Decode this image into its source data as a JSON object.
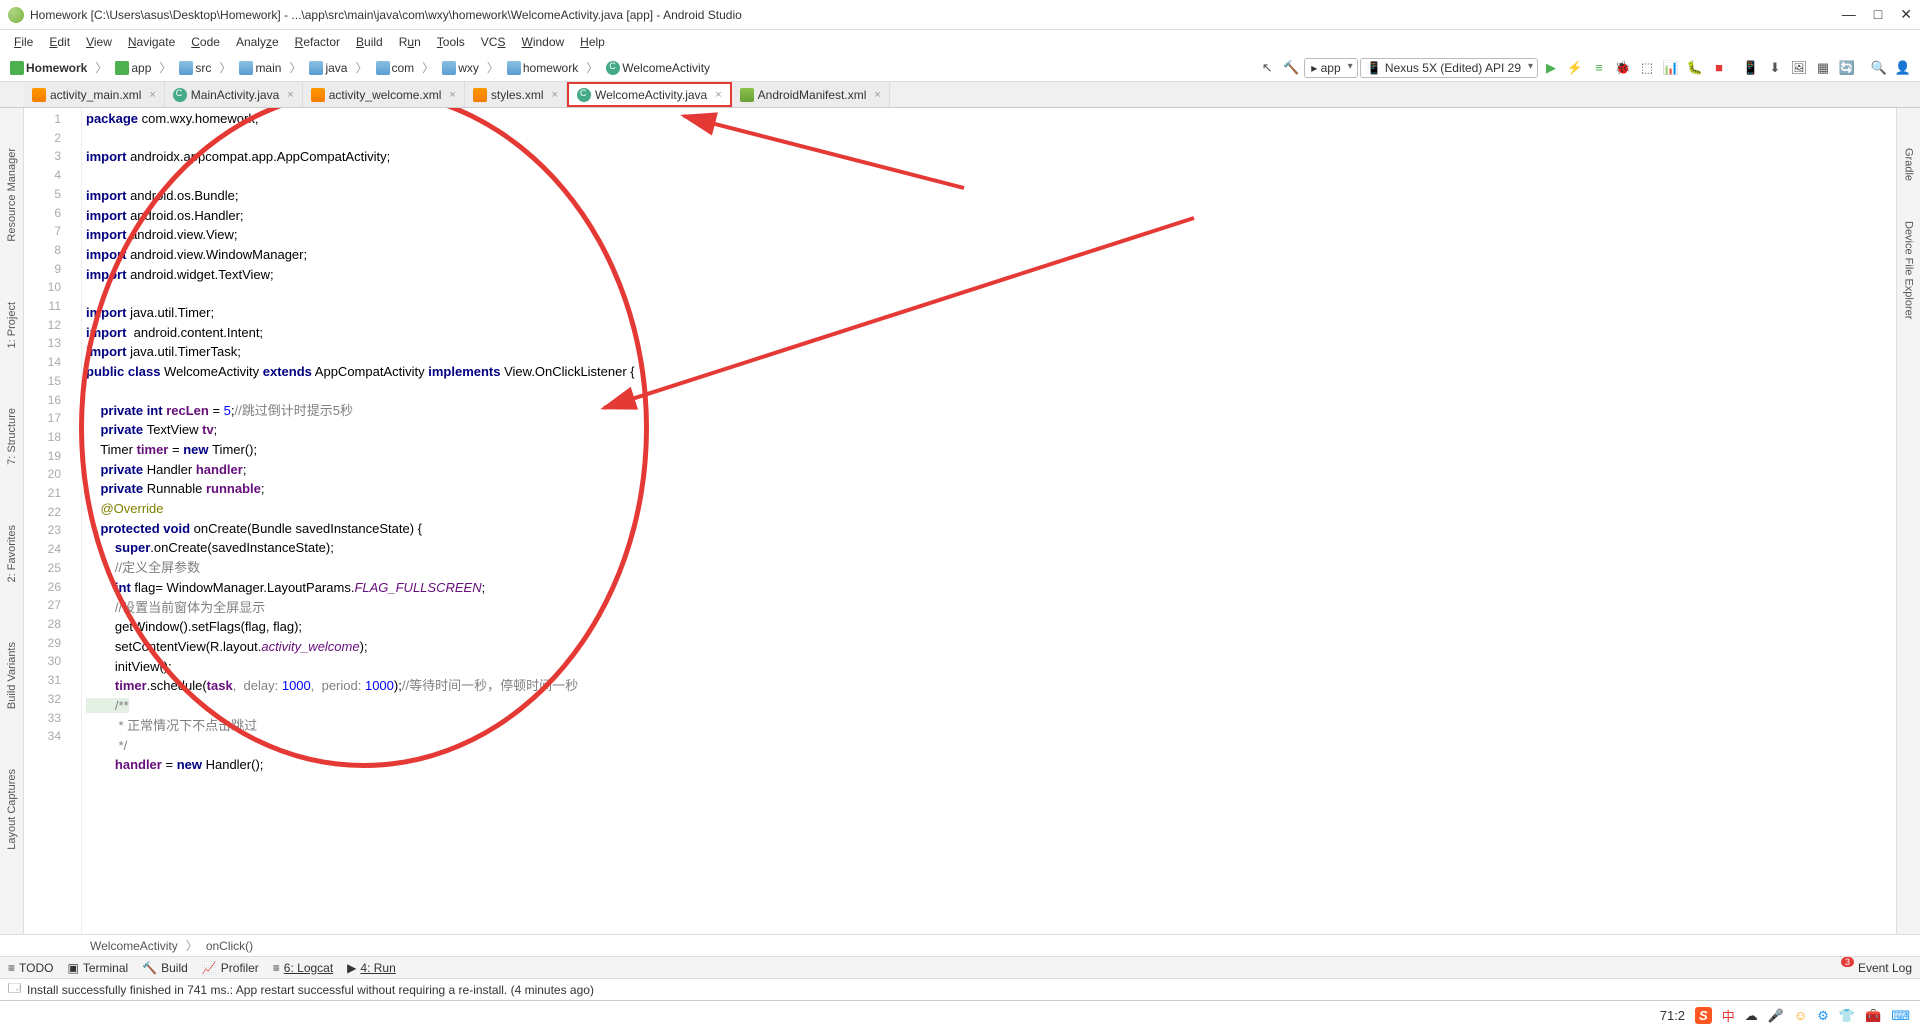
{
  "window": {
    "title": "Homework [C:\\Users\\asus\\Desktop\\Homework] - ...\\app\\src\\main\\java\\com\\wxy\\homework\\WelcomeActivity.java [app] - Android Studio",
    "minimize": "—",
    "maximize": "□",
    "close": "✕"
  },
  "menu": {
    "items": [
      "File",
      "Edit",
      "View",
      "Navigate",
      "Code",
      "Analyze",
      "Refactor",
      "Build",
      "Run",
      "Tools",
      "VCS",
      "Window",
      "Help"
    ]
  },
  "breadcrumb": {
    "items": [
      "Homework",
      "app",
      "src",
      "main",
      "java",
      "com",
      "wxy",
      "homework",
      "WelcomeActivity"
    ]
  },
  "run": {
    "config": "app",
    "device": "Nexus 5X (Edited) API 29"
  },
  "tabs": {
    "items": [
      {
        "label": "activity_main.xml",
        "type": "xml"
      },
      {
        "label": "MainActivity.java",
        "type": "java"
      },
      {
        "label": "activity_welcome.xml",
        "type": "xml"
      },
      {
        "label": "styles.xml",
        "type": "xml"
      },
      {
        "label": "WelcomeActivity.java",
        "type": "java",
        "active": true
      },
      {
        "label": "AndroidManifest.xml",
        "type": "mf"
      }
    ]
  },
  "left_tools": [
    "Resource Manager",
    "1: Project",
    "7: Structure",
    "2: Favorites",
    "Build Variants",
    "Layout Captures"
  ],
  "right_tools": [
    "Gradle",
    "Device File Explorer"
  ],
  "gutter_lines": [
    "1",
    "2",
    "3",
    "4",
    "5",
    "6",
    "7",
    "8",
    "9",
    "10",
    "11",
    "12",
    "13",
    "14",
    "15",
    "16",
    "17",
    "18",
    "19",
    "20",
    "21",
    "22",
    "23",
    "24",
    "25",
    "26",
    "27",
    "28",
    "29",
    "30",
    "31",
    "32",
    "33",
    "34"
  ],
  "code": {
    "l1a": "package",
    "l1b": " com.wxy.homework;",
    "l3a": "import",
    "l3b": " androidx.appcompat.app.AppCompatActivity;",
    "l5a": "import",
    "l5b": " android.os.Bundle;",
    "l6a": "import",
    "l6b": " android.os.Handler;",
    "l7a": "import",
    "l7b": " android.view.View;",
    "l8a": "import",
    "l8b": " android.view.WindowManager;",
    "l9a": "import",
    "l9b": " android.widget.TextView;",
    "l11a": "import",
    "l11b": " java.util.Timer;",
    "l12a": "import",
    "l12b": "  android.content.Intent;",
    "l13a": "import",
    "l13b": " java.util.TimerTask;",
    "l14a": "public class",
    "l14b": " WelcomeActivity ",
    "l14c": "extends",
    "l14d": " AppCompatActivity ",
    "l14e": "implements",
    "l14f": " View.OnClickListener {",
    "l16a": "    private int ",
    "l16b": "recLen",
    "l16c": " = ",
    "l16d": "5",
    "l16e": ";",
    "l16f": "//跳过倒计时提示5秒",
    "l17a": "    private ",
    "l17b": "TextView ",
    "l17c": "tv",
    "l17d": ";",
    "l18a": "    Timer ",
    "l18b": "timer",
    "l18c": " = ",
    "l18d": "new ",
    "l18e": "Timer();",
    "l19a": "    private ",
    "l19b": "Handler ",
    "l19c": "handler",
    "l19d": ";",
    "l20a": "    private ",
    "l20b": "Runnable ",
    "l20c": "runnable",
    "l20d": ";",
    "l21a": "    @Override",
    "l22a": "    protected void ",
    "l22b": "onCreate(Bundle savedInstanceState) {",
    "l23a": "        super",
    "l23b": ".onCreate(savedInstanceState);",
    "l24a": "        //定义全屏参数",
    "l25a": "        int ",
    "l25b": "flag= WindowManager.LayoutParams.",
    "l25c": "FLAG_FULLSCREEN",
    "l25d": ";",
    "l26a": "        //设置当前窗体为全屏显示",
    "l27a": "        getWindow().setFlags(flag, flag);",
    "l28a": "        setContentView(R.layout.",
    "l28b": "activity_welcome",
    "l28c": ");",
    "l29a": "        initView();",
    "l30a": "        timer",
    "l30b": ".schedule(",
    "l30c": "task",
    "l30d": ",  delay: ",
    "l30e": "1000",
    "l30f": ",  period: ",
    "l30g": "1000",
    "l30h": ");",
    "l30i": "//等待时间一秒，停顿时间一秒",
    "l31a": "        /**",
    "l32a": "         * 正常情况下不点击跳过",
    "l33a": "         */",
    "l34a": "        handler",
    "l34b": " = ",
    "l34c": "new ",
    "l34d": "Handler();"
  },
  "crumbs_bottom": {
    "a": "WelcomeActivity",
    "b": "onClick()"
  },
  "bottom_tools": {
    "todo": "TODO",
    "terminal": "Terminal",
    "build": "Build",
    "profiler": "Profiler",
    "logcat": "6: Logcat",
    "run": "4: Run",
    "eventlog": "Event Log",
    "badge": "3"
  },
  "status": {
    "msg": "Install successfully finished in 741 ms.: App restart successful without requiring a re-install. (4 minutes ago)"
  },
  "taskbar": {
    "time": "71:2",
    "ime": "中"
  }
}
